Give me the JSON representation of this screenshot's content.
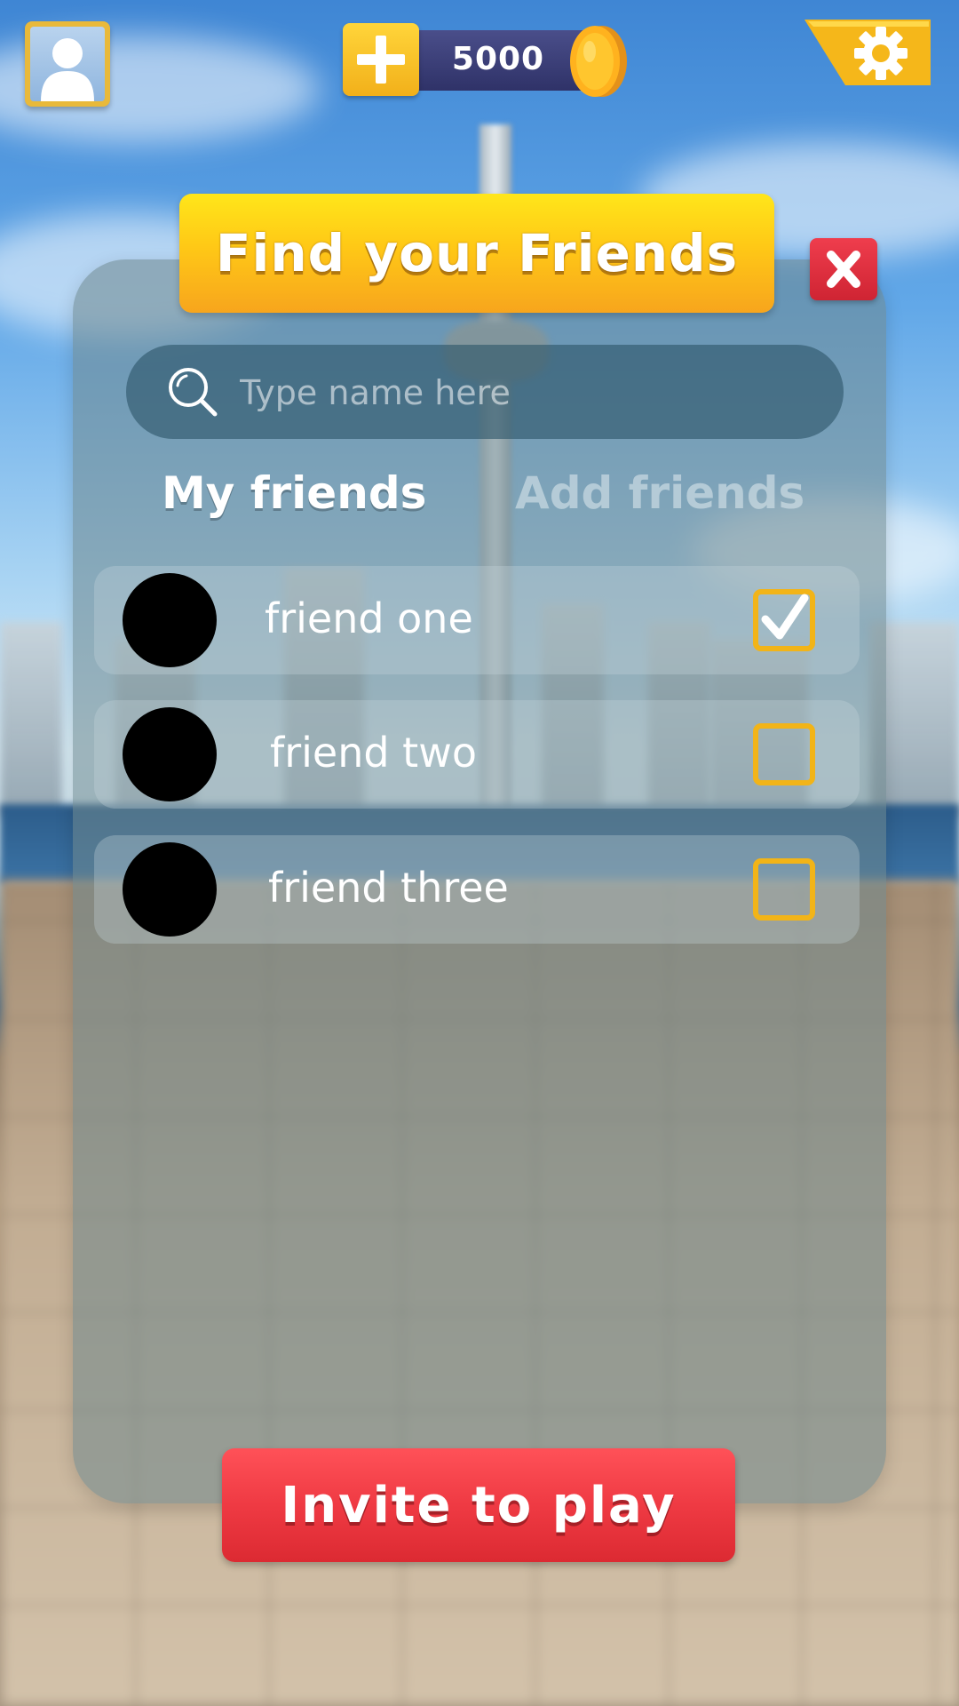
{
  "hud": {
    "profile_icon": "user-silhouette-icon",
    "add_coins_icon": "plus-icon",
    "coin_balance": "5000",
    "coin_icon": "gold-coin-icon",
    "settings_icon": "gear-icon"
  },
  "dialog": {
    "title": "Find your Friends",
    "close_icon": "close-icon",
    "search": {
      "placeholder": "Type name here",
      "value": "",
      "icon": "search-icon"
    },
    "tabs": [
      {
        "label": "My friends",
        "active": true
      },
      {
        "label": "Add friends",
        "active": false
      }
    ],
    "friends": [
      {
        "name": "friend one",
        "selected": true
      },
      {
        "name": "friend two",
        "selected": false
      },
      {
        "name": "friend three",
        "selected": false
      }
    ],
    "invite_button": "Invite to play"
  },
  "colors": {
    "title_banner": "#ffc816",
    "invite_button": "#ef3a43",
    "close_button": "#dc2a32",
    "checkbox_border": "#f2b418",
    "coin_bar": "#3a3d78"
  }
}
